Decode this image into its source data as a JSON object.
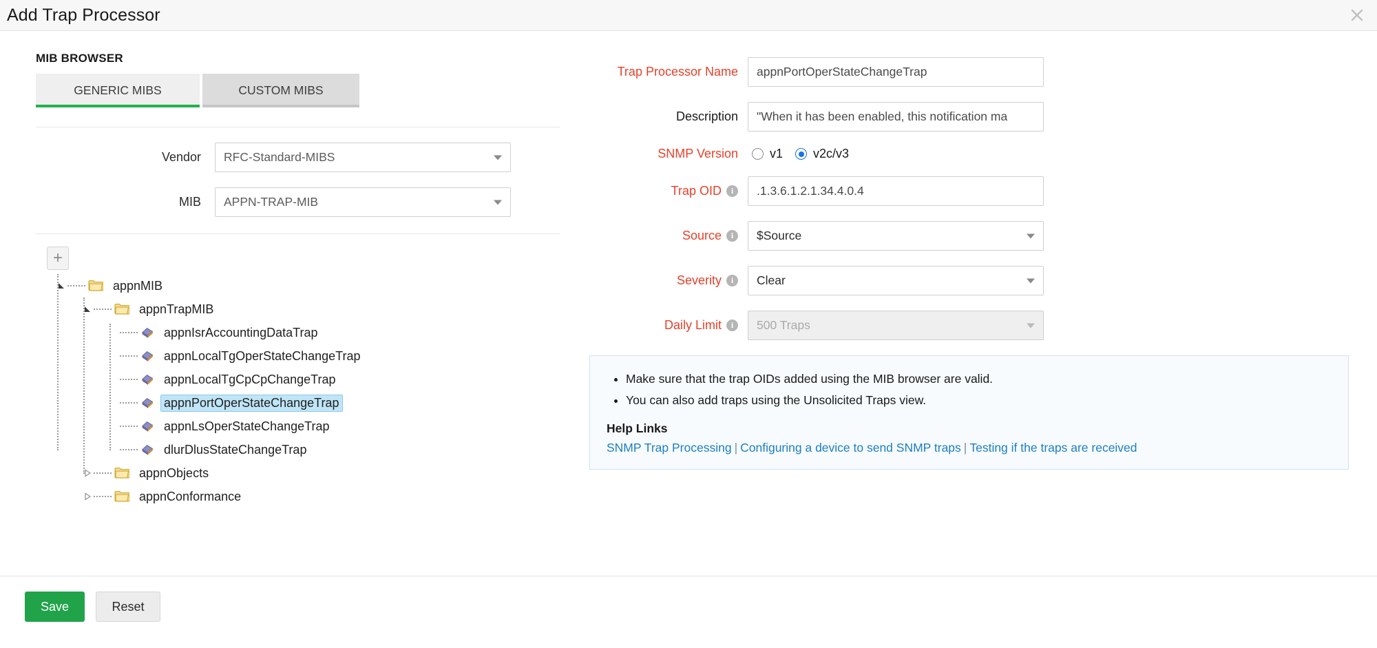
{
  "dialog": {
    "title": "Add Trap Processor",
    "close_icon": "close-icon"
  },
  "mib_browser": {
    "section_label": "MIB BROWSER",
    "tabs": [
      {
        "label": "GENERIC MIBS",
        "active": true
      },
      {
        "label": "CUSTOM MIBS",
        "active": false
      }
    ],
    "vendor": {
      "label": "Vendor",
      "value": "RFC-Standard-MIBS"
    },
    "mib": {
      "label": "MIB",
      "value": "APPN-TRAP-MIB"
    },
    "expand_all_label": "+",
    "tree": [
      {
        "label": "appnMIB",
        "type": "folder",
        "depth": 0,
        "state": "expanded"
      },
      {
        "label": "appnTrapMIB",
        "type": "folder",
        "depth": 1,
        "state": "expanded"
      },
      {
        "label": "appnIsrAccountingDataTrap",
        "type": "leaf",
        "depth": 2,
        "state": "none"
      },
      {
        "label": "appnLocalTgOperStateChangeTrap",
        "type": "leaf",
        "depth": 2,
        "state": "none"
      },
      {
        "label": "appnLocalTgCpCpChangeTrap",
        "type": "leaf",
        "depth": 2,
        "state": "none"
      },
      {
        "label": "appnPortOperStateChangeTrap",
        "type": "leaf",
        "depth": 2,
        "state": "selected"
      },
      {
        "label": "appnLsOperStateChangeTrap",
        "type": "leaf",
        "depth": 2,
        "state": "none"
      },
      {
        "label": "dlurDlusStateChangeTrap",
        "type": "leaf",
        "depth": 2,
        "state": "none"
      },
      {
        "label": "appnObjects",
        "type": "folder",
        "depth": 1,
        "state": "collapsed"
      },
      {
        "label": "appnConformance",
        "type": "folder",
        "depth": 1,
        "state": "collapsed"
      }
    ]
  },
  "form": {
    "trap_processor_name": {
      "label": "Trap Processor Name",
      "value": "appnPortOperStateChangeTrap",
      "required": true
    },
    "description": {
      "label": "Description",
      "value": "\"When it has been enabled, this notification ma",
      "required": false
    },
    "snmp_version": {
      "label": "SNMP Version",
      "required": true,
      "options": [
        {
          "label": "v1",
          "selected": false
        },
        {
          "label": "v2c/v3",
          "selected": true
        }
      ]
    },
    "trap_oid": {
      "label": "Trap OID",
      "value": ".1.3.6.1.2.1.34.4.0.4",
      "required": true,
      "info_icon": "info-icon"
    },
    "source": {
      "label": "Source",
      "value": "$Source",
      "required": true,
      "info_icon": "info-icon"
    },
    "severity": {
      "label": "Severity",
      "value": "Clear",
      "required": true,
      "info_icon": "info-icon"
    },
    "daily_limit": {
      "label": "Daily Limit",
      "value": "500 Traps",
      "required": true,
      "disabled": true,
      "info_icon": "info-icon"
    }
  },
  "help": {
    "bullets": [
      "Make sure that the trap OIDs added using the MIB browser are valid.",
      "You can also add traps using the Unsolicited Traps view."
    ],
    "links_title": "Help Links",
    "links": [
      "SNMP Trap Processing",
      "Configuring a device to send SNMP traps",
      "Testing if the traps are received"
    ],
    "separator": "|"
  },
  "footer": {
    "save_label": "Save",
    "reset_label": "Reset"
  },
  "colors": {
    "accent_green": "#22b24c",
    "required_red": "#e8402a",
    "link_blue": "#1d7ec4",
    "radio_blue": "#1673e6",
    "selection_blue": "#bfe5f7"
  }
}
